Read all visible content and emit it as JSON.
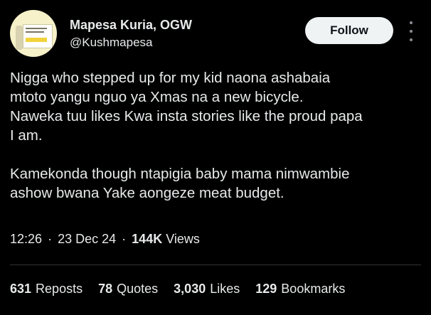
{
  "author": {
    "name": "Mapesa Kuria, OGW",
    "handle": "@Kushmapesa"
  },
  "follow_label": "Follow",
  "tweet": {
    "lines_p1": [
      "Nigga who stepped up for my kid naona ashabaia",
      "mtoto yangu nguo ya Xmas na a new bicycle.",
      "Naweka tuu likes Kwa insta stories like the proud papa",
      "I am."
    ],
    "lines_p2": [
      "Kamekonda though ntapigia baby mama nimwambie",
      "ashow bwana Yake aongeze meat budget."
    ]
  },
  "meta": {
    "time": "12:26",
    "date": "23 Dec 24",
    "views_count": "144K",
    "views_label": "Views",
    "separator": "·"
  },
  "stats": {
    "reposts_count": "631",
    "reposts_label": "Reposts",
    "quotes_count": "78",
    "quotes_label": "Quotes",
    "likes_count": "3,030",
    "likes_label": "Likes",
    "bookmarks_count": "129",
    "bookmarks_label": "Bookmarks"
  },
  "colors": {
    "background": "#000000",
    "text": "#e7e9ea",
    "follow_bg": "#eff3f4",
    "follow_text": "#0f1419",
    "divider": "#2f3336"
  },
  "icons": [
    "more-options-icon"
  ]
}
